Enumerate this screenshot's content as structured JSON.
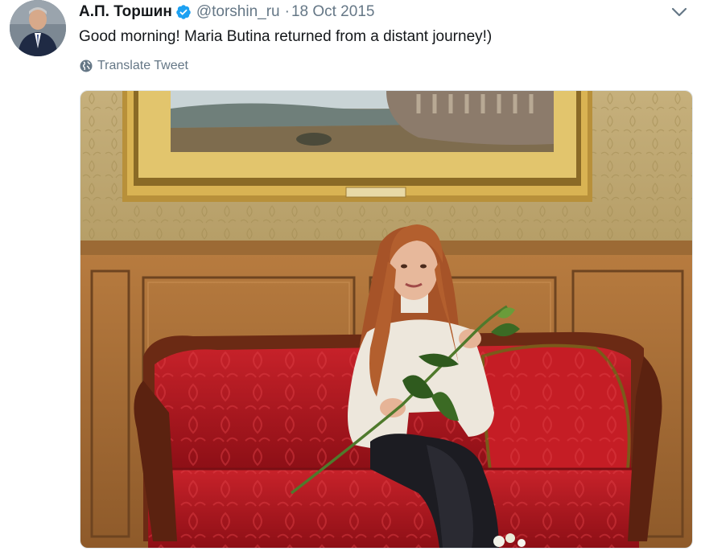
{
  "tweet": {
    "display_name": "А.П. Торшин",
    "handle": "@torshin_ru",
    "separator": "·",
    "date": "18 Oct 2015",
    "text": "Good morning! Maria Butina returned from a distant journey!)",
    "translate_label": "Translate Tweet",
    "verified": true
  },
  "icons": {
    "verified": "verified-badge-icon",
    "caret": "chevron-down-icon",
    "translate": "globe-icon"
  },
  "colors": {
    "secondary_text": "#657786",
    "verified_blue": "#1da1f2",
    "sofa_red": "#b0141c",
    "wall_wood": "#a06a33"
  }
}
